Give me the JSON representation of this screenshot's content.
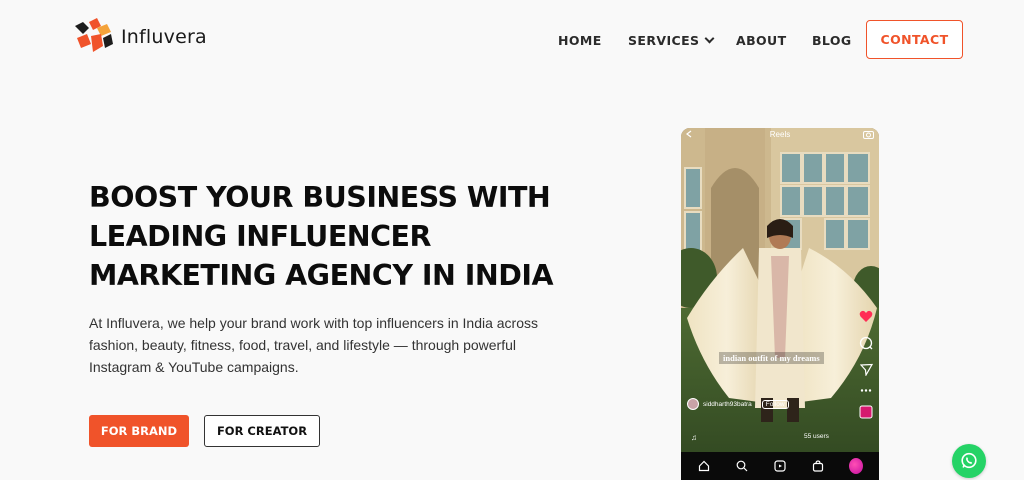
{
  "header": {
    "logo_text": "Influvera",
    "nav": {
      "home": "HOME",
      "services": "SERVICES",
      "about": "ABOUT",
      "blog": "BLOG"
    },
    "contact_label": "CONTACT"
  },
  "hero": {
    "title_lines": [
      "BOOST YOUR BUSINESS WITH",
      "LEADING INFLUENCER",
      "MARKETING AGENCY IN INDIA"
    ],
    "description": "At Influvera, we help your brand work with top influencers in India across fashion, beauty, fitness, food, travel, and lifestyle — through powerful Instagram & YouTube campaigns.",
    "buttons": {
      "brand": "FOR BRAND",
      "creator": "FOR CREATOR"
    }
  },
  "phone": {
    "top_label": "Reels",
    "caption": "indian outfit of my dreams",
    "username": "siddharth93batra",
    "follow_label": "Follow",
    "users_count": "55 users"
  },
  "colors": {
    "accent": "#f0532a",
    "whatsapp": "#25d366",
    "like": "#ff2d55"
  },
  "icons": [
    "chevron-down-icon",
    "home-icon",
    "search-icon",
    "reels-icon",
    "shop-icon",
    "heart-icon",
    "comment-icon",
    "share-icon",
    "camera-icon",
    "whatsapp-icon"
  ]
}
